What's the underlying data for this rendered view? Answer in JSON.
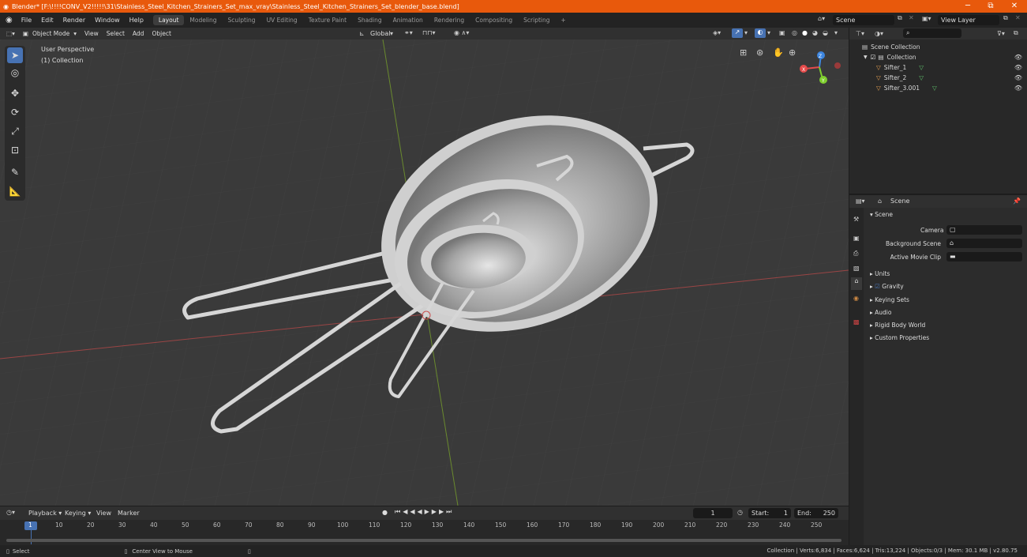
{
  "window": {
    "title": "Blender* [F:\\!!!!CONV_V2!!!!!\\31\\Stainless_Steel_Kitchen_Strainers_Set_max_vray\\Stainless_Steel_Kitchen_Strainers_Set_blender_base.blend]",
    "minimize": "─",
    "maximize": "⧉",
    "close": "✕"
  },
  "menu": [
    "File",
    "Edit",
    "Render",
    "Window",
    "Help"
  ],
  "workspaces": [
    "Layout",
    "Modeling",
    "Sculpting",
    "UV Editing",
    "Texture Paint",
    "Shading",
    "Animation",
    "Rendering",
    "Compositing",
    "Scripting"
  ],
  "topright": {
    "scene": "Scene",
    "view_layer": "View Layer"
  },
  "viewport_header": {
    "mode": "Object Mode",
    "menus": [
      "View",
      "Select",
      "Add",
      "Object"
    ],
    "orientation": "Global"
  },
  "viewport": {
    "line1": "User Perspective",
    "line2": "(1) Collection",
    "axes": {
      "x": "X",
      "y": "Y",
      "z": "Z"
    }
  },
  "outliner": {
    "root": "Scene Collection",
    "collection": "Collection",
    "items": [
      "Sifter_1",
      "Sifter_2",
      "Sifter_3.001"
    ]
  },
  "properties": {
    "context": "Scene",
    "panel": "Scene",
    "camera_label": "Camera",
    "bg_label": "Background Scene",
    "clip_label": "Active Movie Clip",
    "sections": [
      "Units",
      "Gravity",
      "Keying Sets",
      "Audio",
      "Rigid Body World",
      "Custom Properties"
    ]
  },
  "timeline": {
    "menus": [
      "Playback",
      "Keying",
      "View",
      "Marker"
    ],
    "current": "1",
    "start_label": "Start:",
    "start": "1",
    "end_label": "End:",
    "end": "250",
    "ticks": [
      "1",
      "10",
      "20",
      "30",
      "40",
      "50",
      "60",
      "70",
      "80",
      "90",
      "100",
      "110",
      "120",
      "130",
      "140",
      "150",
      "160",
      "170",
      "180",
      "190",
      "200",
      "210",
      "220",
      "230",
      "240",
      "250"
    ]
  },
  "status": {
    "select": "Select",
    "center": "Center View to Mouse",
    "stats": "Collection | Verts:6,834 | Faces:6,624 | Tris:13,224 | Objects:0/3 | Mem: 30.1 MB | v2.80.75"
  },
  "colors": {
    "accent": "#4772b3",
    "titlebar": "#e8590c",
    "x_axis": "#e54b4b",
    "y_axis": "#7fcf2e",
    "z_axis": "#3d86e0"
  }
}
